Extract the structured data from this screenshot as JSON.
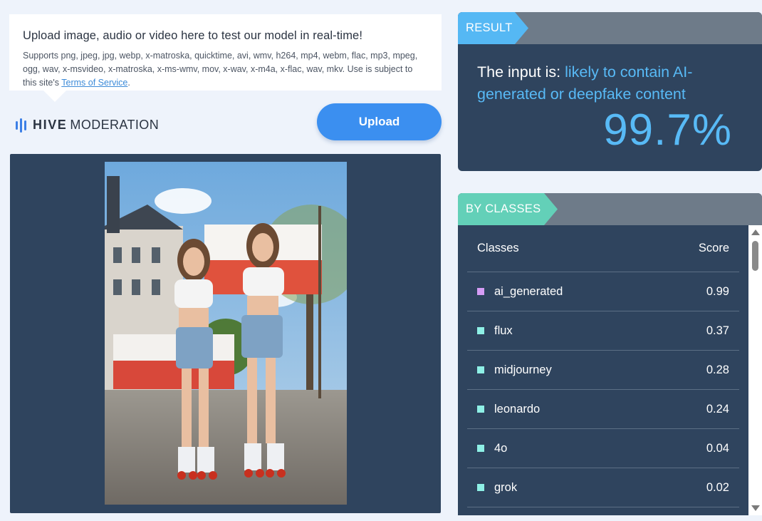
{
  "upload": {
    "title": "Upload image, audio or video here to test our model in real-time!",
    "description_prefix": "Supports png, jpeg, jpg, webp, x-matroska, quicktime, avi, wmv, h264, mp4, webm, flac, mp3, mpeg, ogg, wav, x-msvideo, x-matroska, x-ms-wmv, mov, x-wav, x-m4a, x-flac, wav, mkv. Use is subject to this site's ",
    "terms_link": "Terms of Service",
    "description_suffix": ".",
    "button_label": "Upload"
  },
  "logo": {
    "bold": "HIVE",
    "light": "MODERATION",
    "icon": "hive-logo-icon"
  },
  "result": {
    "tag": "RESULT",
    "prefix": "The input is: ",
    "verdict": "likely to contain AI-generated or deepfake content",
    "score": "99.7%"
  },
  "classes": {
    "tag": "BY CLASSES",
    "header_class": "Classes",
    "header_score": "Score",
    "rows": [
      {
        "name": "ai_generated",
        "score": "0.99",
        "color": "#d59cf5"
      },
      {
        "name": "flux",
        "score": "0.37",
        "color": "#8ef0e6"
      },
      {
        "name": "midjourney",
        "score": "0.28",
        "color": "#8ef0e6"
      },
      {
        "name": "leonardo",
        "score": "0.24",
        "color": "#8ef0e6"
      },
      {
        "name": "4o",
        "score": "0.04",
        "color": "#8ef0e6"
      },
      {
        "name": "grok",
        "score": "0.02",
        "color": "#8ef0e6"
      }
    ]
  },
  "colors": {
    "accent_blue": "#58baf6",
    "panel": "#2f445e",
    "button": "#3b8ff0",
    "classes_tag": "#63d0b8"
  }
}
